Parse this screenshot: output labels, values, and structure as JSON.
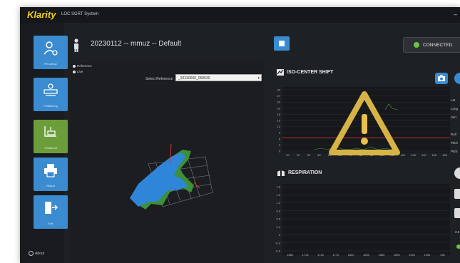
{
  "app": {
    "logo": "Klarity",
    "title": "LOC SGRT System"
  },
  "sidebar": {
    "items": [
      {
        "label": "Pre-setup",
        "icon": "person-settings-icon"
      },
      {
        "label": "Positioning",
        "icon": "patient-position-icon"
      },
      {
        "label": "Treatment",
        "icon": "treatment-icon"
      },
      {
        "label": "Report",
        "icon": "printer-icon"
      },
      {
        "label": "Exit",
        "icon": "exit-door-icon"
      }
    ],
    "about": "About"
  },
  "header": {
    "session": "20230112 -- mmuz -- Default",
    "connection": "CONNECTED"
  },
  "viewer": {
    "radio_reference": "Reference",
    "radio_live": "Live",
    "select_label": "Select Reference",
    "select_value": "_20230000_050530"
  },
  "iso_panel": {
    "title": "ISO-CENTER SHIFT",
    "y_ticks": [
      "30",
      "27",
      "24",
      "21",
      "18",
      "15",
      "12",
      "9",
      "6",
      "3",
      "0"
    ],
    "x_ticks": [
      "10",
      "20",
      "30",
      "40",
      "50",
      "60",
      "70",
      "80",
      "90",
      "100",
      "110",
      "120",
      "130",
      "140",
      "150",
      "160"
    ],
    "side_labels": [
      "Lat",
      "Long",
      "Vert",
      "Roll",
      "Pitch",
      "Pit/S"
    ]
  },
  "respiration_panel": {
    "title": "RESPIRATION",
    "y_ticks": [
      "1.8",
      "1.5",
      "1.2",
      "0.9",
      "0.6",
      "0.3",
      "0",
      "-0.3",
      "-0.6"
    ],
    "x_ticks": [
      "1680",
      "1710",
      "1740",
      "1770",
      "1800",
      "1830",
      "1860",
      "1890",
      "1920",
      "1950",
      "198"
    ],
    "side_label": "2.5"
  },
  "colors": {
    "accent": "#3a8bd0",
    "treatment": "#6b9e3a",
    "connected": "#6cc24a",
    "warning": "#e8c14a",
    "threshold": "#c0282c"
  }
}
